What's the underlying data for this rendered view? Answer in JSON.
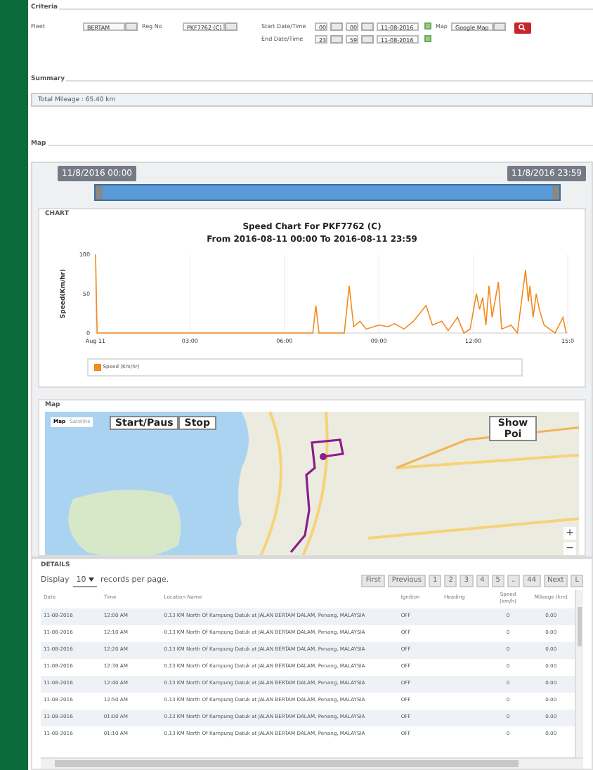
{
  "criteria": {
    "legend": "Criteria",
    "fleet": {
      "label": "Fleet",
      "value": "BERTAM"
    },
    "reg_no": {
      "label": "Reg No",
      "value": "PKF7762 (C)"
    },
    "start": {
      "label": "Start Date/Time",
      "hour": "00",
      "minute": "00",
      "date": "11-08-2016"
    },
    "end": {
      "label": "End Date/Time",
      "hour": "23",
      "minute": "59",
      "date": "11-08-2016"
    },
    "map": {
      "label": "Map",
      "value": "Google Map"
    }
  },
  "summary": {
    "legend": "Summary",
    "text": "Total Mileage : 65.40 km"
  },
  "map_section": {
    "legend": "Map",
    "range_start": "11/8/2016 00:00",
    "range_end": "11/8/2016 23:59",
    "slider_handles": [
      {
        "level": 0
      },
      {
        "level": 1
      }
    ],
    "chart_legend": "CHART",
    "chart_subtitle": "From 2016-08-11 00:00 To 2016-08-11 23:59",
    "chart_data": {
      "type": "line",
      "grid": true,
      "title": "Speed Chart For PKF7762 (C)",
      "ylabel": "Speed(Km/hr)",
      "xlim": [
        0,
        15
      ],
      "ylim": [
        0,
        100
      ],
      "xticks": [
        {
          "value": 0,
          "label": "Aug 11"
        },
        {
          "value": 3,
          "label": "03:00"
        },
        {
          "value": 6,
          "label": "06:00"
        },
        {
          "value": 9,
          "label": "09:00"
        },
        {
          "value": 12,
          "label": "12:00"
        },
        {
          "value": 15,
          "label": "15:0"
        }
      ],
      "yticks": [
        0,
        50,
        100
      ],
      "x": [
        0,
        0.05,
        6.9,
        7.0,
        7.1,
        7.9,
        8.06,
        8.2,
        8.4,
        8.6,
        9.0,
        9.3,
        9.5,
        9.8,
        10.1,
        10.3,
        10.5,
        10.7,
        11.0,
        11.2,
        11.5,
        11.7,
        11.9,
        12.1,
        12.2,
        12.3,
        12.4,
        12.5,
        12.6,
        12.8,
        12.9,
        13.2,
        13.4,
        13.66,
        13.75,
        13.8,
        13.9,
        14.0,
        14.1,
        14.25,
        14.6,
        14.85,
        14.95
      ],
      "series": [
        {
          "name": "Speed (Km/hr)",
          "color": "#f28a1e",
          "values": [
            100,
            0,
            0,
            35,
            0,
            0,
            60,
            8,
            15,
            5,
            10,
            8,
            12,
            5,
            15,
            25,
            35,
            10,
            15,
            3,
            20,
            0,
            5,
            50,
            30,
            45,
            10,
            60,
            20,
            65,
            5,
            10,
            0,
            80,
            40,
            60,
            20,
            50,
            30,
            10,
            0,
            20,
            0
          ]
        }
      ]
    },
    "map_legend": "Map",
    "map_types": [
      {
        "label": "Map",
        "selected": true
      },
      {
        "label": "Satellite",
        "selected": false
      }
    ],
    "buttons": [
      "Start/Paus",
      "Stop"
    ],
    "poi_button": "Show Poi",
    "zoom": [
      "+",
      "−"
    ]
  },
  "details": {
    "legend": "DETAILS",
    "display_label": "Display",
    "page_size": "10",
    "records_label": "records per page.",
    "pager": [
      "First",
      "Previous",
      "1",
      "2",
      "3",
      "4",
      "5",
      "..",
      "44",
      "Next",
      "L"
    ],
    "columns": [
      "Date",
      "Time",
      "Location Name",
      "Ignition",
      "Heading",
      "Speed (km/h)",
      "Mileage (km)"
    ],
    "rows": [
      [
        "11-08-2016",
        "12:00 AM",
        "0.13 KM North Of Kampung Datuk at JALAN BERTAM DALAM, Penang, MALAYSIA",
        "OFF",
        "",
        "0",
        "0.00"
      ],
      [
        "11-08-2016",
        "12:10 AM",
        "0.13 KM North Of Kampung Datuk at JALAN BERTAM DALAM, Penang, MALAYSIA",
        "OFF",
        "",
        "0",
        "0.00"
      ],
      [
        "11-08-2016",
        "12:20 AM",
        "0.13 KM North Of Kampung Datuk at JALAN BERTAM DALAM, Penang, MALAYSIA",
        "OFF",
        "",
        "0",
        "0.00"
      ],
      [
        "11-08-2016",
        "12:30 AM",
        "0.13 KM North Of Kampung Datuk at JALAN BERTAM DALAM, Penang, MALAYSIA",
        "OFF",
        "",
        "0",
        "0.00"
      ],
      [
        "11-08-2016",
        "12:40 AM",
        "0.13 KM North Of Kampung Datuk at JALAN BERTAM DALAM, Penang, MALAYSIA",
        "OFF",
        "",
        "0",
        "0.00"
      ],
      [
        "11-08-2016",
        "12:50 AM",
        "0.13 KM North Of Kampung Datuk at JALAN BERTAM DALAM, Penang, MALAYSIA",
        "OFF",
        "",
        "0",
        "0.00"
      ],
      [
        "11-08-2016",
        "01:00 AM",
        "0.13 KM North Of Kampung Datuk at JALAN BERTAM DALAM, Penang, MALAYSIA",
        "OFF",
        "",
        "0",
        "0.00"
      ],
      [
        "11-08-2016",
        "01:10 AM",
        "0.13 KM North Of Kampung Datuk at JALAN BERTAM DALAM, Penang, MALAYSIA",
        "OFF",
        "",
        "0",
        "0.00"
      ]
    ]
  }
}
